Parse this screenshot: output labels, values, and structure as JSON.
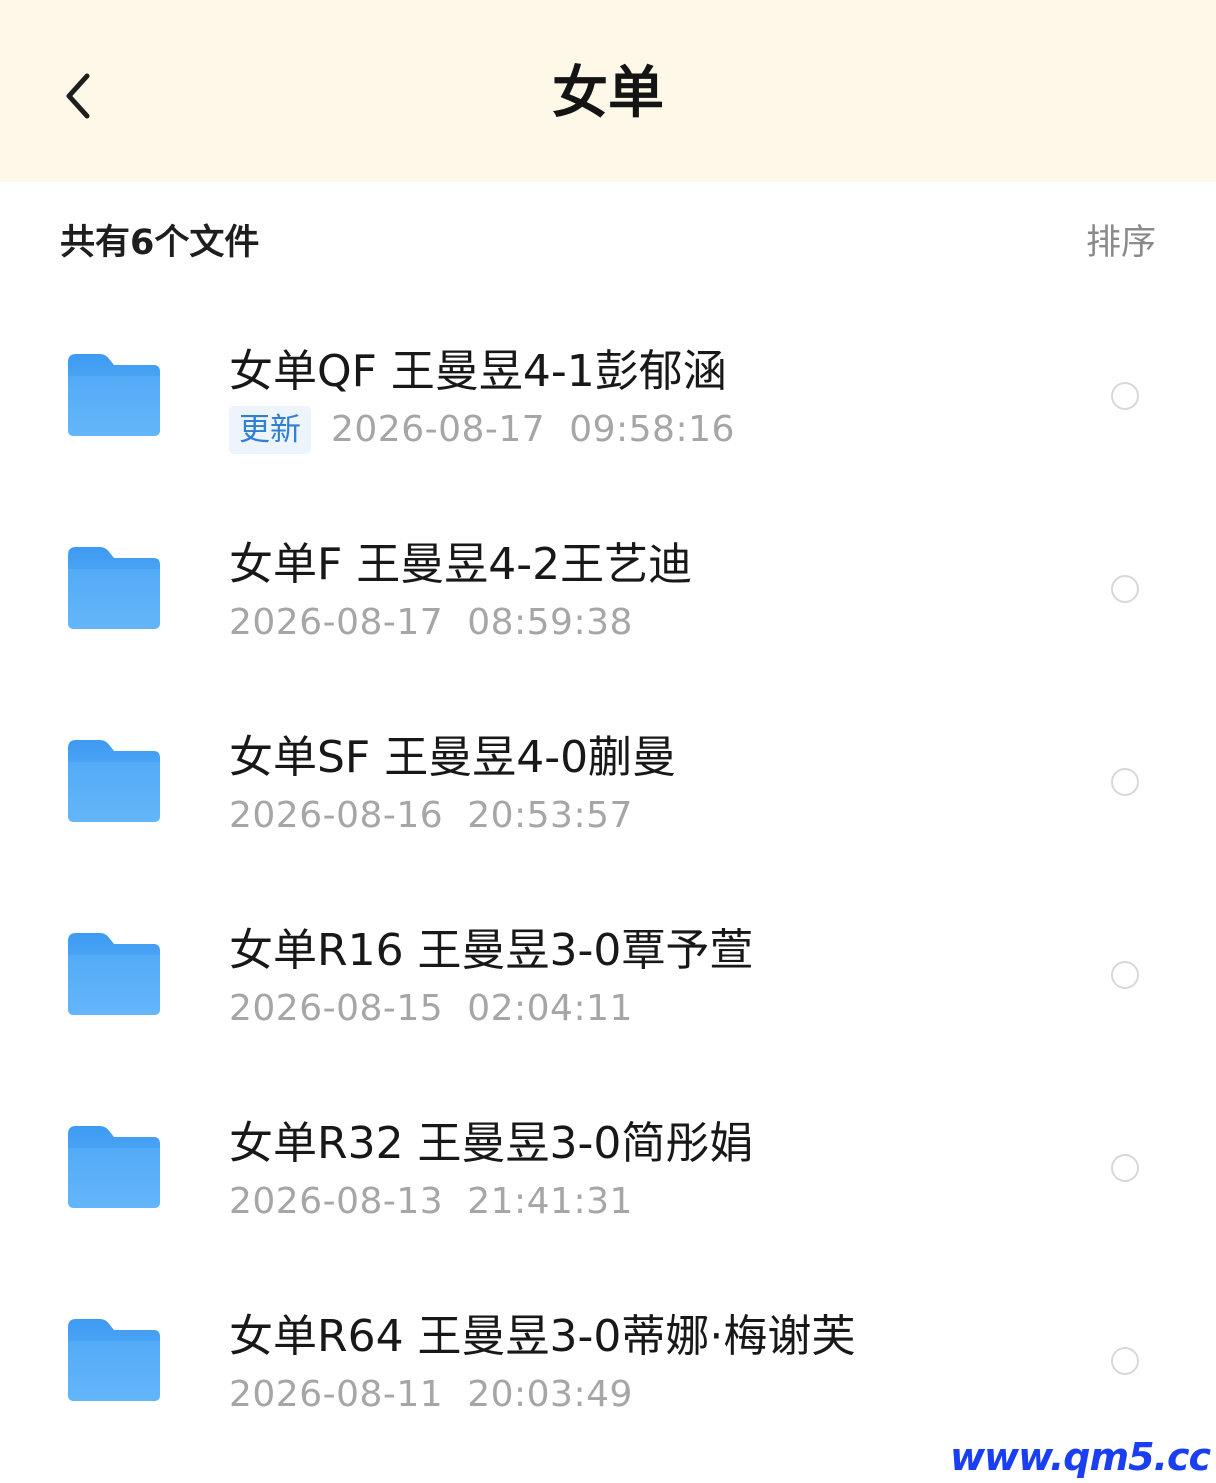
{
  "header": {
    "title": "女单",
    "back_icon": "chevron-left-icon"
  },
  "summary": {
    "count_text": "共有6个文件",
    "sort_label": "排序"
  },
  "colors": {
    "header_bg": "#fdf8e8",
    "folder_blue": "#4aa4f5",
    "badge_text": "#2f7fd4"
  },
  "files": [
    {
      "name": "女单QF 王曼昱4-1彭郁涵",
      "badge": "更新",
      "date": "2026-08-17",
      "time": "09:58:16",
      "icon": "folder-icon"
    },
    {
      "name": "女单F 王曼昱4-2王艺迪",
      "date": "2026-08-17",
      "time": "08:59:38",
      "icon": "folder-icon"
    },
    {
      "name": "女单SF 王曼昱4-0蒯曼",
      "date": "2026-08-16",
      "time": "20:53:57",
      "icon": "folder-icon"
    },
    {
      "name": "女单R16 王曼昱3-0覃予萱",
      "date": "2026-08-15",
      "time": "02:04:11",
      "icon": "folder-icon"
    },
    {
      "name": "女单R32 王曼昱3-0简彤娟",
      "date": "2026-08-13",
      "time": "21:41:31",
      "icon": "folder-icon"
    },
    {
      "name": "女单R64 王曼昱3-0蒂娜·梅谢芙",
      "date": "2026-08-11",
      "time": "20:03:49",
      "icon": "folder-icon"
    }
  ],
  "watermark": "www.qm5.cc"
}
